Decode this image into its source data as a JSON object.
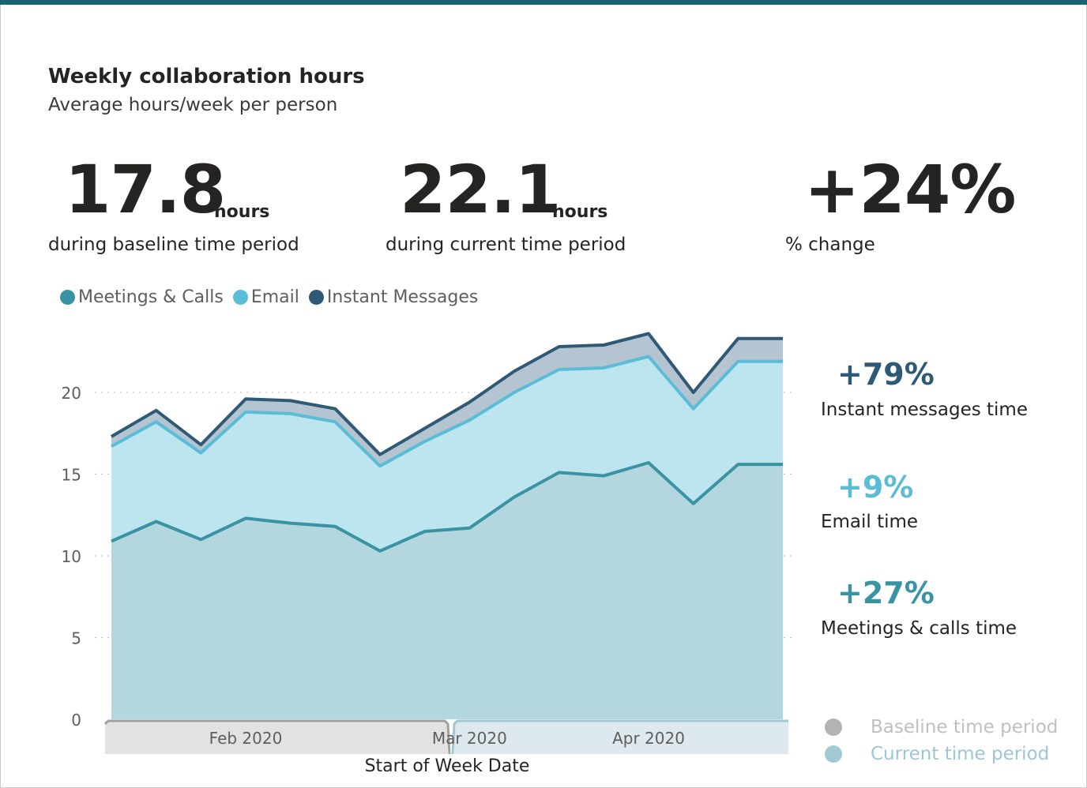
{
  "header": {
    "title": "Weekly collaboration hours",
    "subtitle": "Average hours/week per person"
  },
  "kpis": {
    "baseline": {
      "value": "17.8",
      "unit": "hours",
      "label": "during baseline time period"
    },
    "current": {
      "value": "22.1",
      "unit": "hours",
      "label": "during current time period"
    },
    "change": {
      "value": "+24%",
      "label": "% change"
    }
  },
  "legend": [
    {
      "label": "Meetings & Calls",
      "color": "#3a93a3"
    },
    {
      "label": "Email",
      "color": "#5bbcd6"
    },
    {
      "label": "Instant Messages",
      "color": "#2f5a75"
    }
  ],
  "changes": [
    {
      "value": "+79%",
      "label": "Instant messages time",
      "color": "#2f5a75"
    },
    {
      "value": "+9%",
      "label": "Email time",
      "color": "#5bbcd6"
    },
    {
      "value": "+27%",
      "label": "Meetings & calls time",
      "color": "#3a93a3"
    }
  ],
  "period_legend": [
    {
      "label": "Baseline time period",
      "dot_color": "#b3b3b3",
      "text_color": "#c0c0c0"
    },
    {
      "label": "Current time period",
      "dot_color": "#a3c9d3",
      "text_color": "#9cc7d3"
    }
  ],
  "colors": {
    "topbar": "#1a6373",
    "meetings_fill": "#b4d6de",
    "email_fill": "#bde5ef",
    "im_fill": "#b4c4d1",
    "baseline_band": "#e2e2e2",
    "current_band": "#dde9ee",
    "baseline_band_edge": "#a0a0a0",
    "current_band_edge": "#9fc6d1"
  },
  "chart_data": {
    "type": "area",
    "stacked": true,
    "title": "",
    "xlabel": "Start of Week Date",
    "ylabel": "",
    "ylim": [
      0,
      23.5
    ],
    "yticks": [
      0,
      5,
      10,
      15,
      20
    ],
    "grid": true,
    "legend_position": "top-left",
    "x": [
      "2020-01-05",
      "2020-01-12",
      "2020-01-19",
      "2020-01-26",
      "2020-02-02",
      "2020-02-09",
      "2020-02-16",
      "2020-02-23",
      "2020-03-01",
      "2020-03-08",
      "2020-03-15",
      "2020-03-22",
      "2020-03-29",
      "2020-04-05",
      "2020-04-12",
      "2020-04-19"
    ],
    "x_tick_labels": [
      {
        "label": "Feb 2020",
        "x": "2020-01-26"
      },
      {
        "label": "Mar 2020",
        "x": "2020-03-01"
      },
      {
        "label": "Apr 2020",
        "x": "2020-03-29"
      }
    ],
    "series": [
      {
        "name": "Meetings & Calls",
        "values": [
          10.9,
          12.1,
          11.0,
          12.3,
          12.0,
          11.8,
          10.3,
          11.5,
          11.7,
          13.6,
          15.1,
          14.9,
          15.7,
          13.2,
          15.6,
          15.6
        ]
      },
      {
        "name": "Email",
        "values": [
          5.8,
          6.1,
          5.3,
          6.5,
          6.7,
          6.4,
          5.2,
          5.5,
          6.6,
          6.4,
          6.3,
          6.6,
          6.5,
          5.8,
          6.3,
          6.3
        ]
      },
      {
        "name": "Instant Messages",
        "values": [
          0.6,
          0.7,
          0.5,
          0.8,
          0.8,
          0.8,
          0.7,
          0.8,
          1.1,
          1.3,
          1.4,
          1.4,
          1.4,
          1.0,
          1.4,
          1.4
        ]
      }
    ],
    "periods": [
      {
        "name": "Baseline time period",
        "from": "2020-01-05",
        "to": "2020-02-23"
      },
      {
        "name": "Current time period",
        "from": "2020-03-01",
        "to": "2020-04-19"
      }
    ]
  }
}
